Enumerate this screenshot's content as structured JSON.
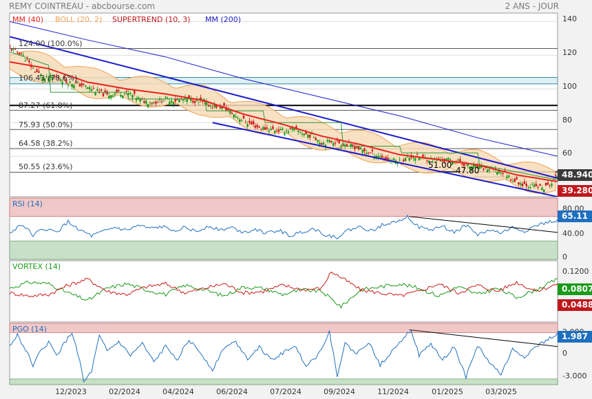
{
  "header": {
    "title": "REMY COINTREAU - abcbourse.com",
    "period": "2 ANS - JOUR"
  },
  "colors": {
    "mm40": "#e8231c",
    "boll": "#f0a050",
    "supertrend": "#c0181c",
    "mm200": "#1a1acc",
    "channel": "#1a1acc",
    "rsi": "#1f6fbf",
    "vortex_plus": "#1a9a1a",
    "vortex_minus": "#cc1a1a",
    "pgo": "#1f6fbf",
    "overbought_zone": "#f0c8c8",
    "oversold_zone": "#c8e0c8",
    "badge_price": "#3a3a3a",
    "badge_red": "#c0181c",
    "badge_blue": "#1f6fbf",
    "badge_green": "#1a9a1a"
  },
  "chart_data": [
    {
      "type": "line",
      "title": "",
      "legend": [
        {
          "name": "MM (40)",
          "color": "#e8231c"
        },
        {
          "name": "BOLL (20, 2)",
          "color": "#f0a050"
        },
        {
          "name": "SUPERTREND (10, 3)",
          "color": "#c0181c"
        },
        {
          "name": "MM (200)",
          "color": "#1a1acc"
        }
      ],
      "ylim": [
        36,
        145
      ],
      "yticks": [
        140,
        120,
        100,
        80,
        60
      ],
      "x_labels": [
        "12/2023",
        "02/2024",
        "04/2024",
        "06/2024",
        "07/2024",
        "09/2024",
        "11/2024",
        "01/2025",
        "03/2025"
      ],
      "x_label_index": [
        20,
        50,
        80,
        110,
        140,
        170,
        200,
        230,
        260
      ],
      "n_points": 282,
      "fibonacci": [
        {
          "label": "124.00  (100.0%)",
          "value": 124.0
        },
        {
          "label": "106.43  (78.6%)",
          "value": 106.43
        },
        {
          "label": "87.27  (61.8%)",
          "value": 87.27
        },
        {
          "label": "75.93  (50.0%)",
          "value": 75.93
        },
        {
          "label": "64.58  (38.2%)",
          "value": 64.58
        },
        {
          "label": "50.55  (23.6%)",
          "value": 50.55
        }
      ],
      "horizontal_lines": [
        106.8,
        103.0,
        90.2
      ],
      "annotations": [
        {
          "label": "51.00",
          "x": 222,
          "y": 51.0
        },
        {
          "label": "47.80",
          "x": 246,
          "y": 47.8
        }
      ],
      "close_points": [
        [
          0,
          124
        ],
        [
          6,
          121
        ],
        [
          12,
          112
        ],
        [
          18,
          106
        ],
        [
          24,
          107
        ],
        [
          30,
          104
        ],
        [
          38,
          102
        ],
        [
          44,
          99
        ],
        [
          50,
          96
        ],
        [
          55,
          98
        ],
        [
          62,
          97
        ],
        [
          68,
          93
        ],
        [
          74,
          92
        ],
        [
          80,
          94
        ],
        [
          86,
          93
        ],
        [
          92,
          94
        ],
        [
          98,
          92
        ],
        [
          104,
          90
        ],
        [
          110,
          89
        ],
        [
          116,
          84
        ],
        [
          122,
          80
        ],
        [
          128,
          77
        ],
        [
          134,
          76
        ],
        [
          140,
          75
        ],
        [
          146,
          76
        ],
        [
          152,
          73
        ],
        [
          156,
          72
        ],
        [
          160,
          68
        ],
        [
          166,
          69
        ],
        [
          172,
          67
        ],
        [
          176,
          66
        ],
        [
          182,
          63
        ],
        [
          188,
          61
        ],
        [
          194,
          58
        ],
        [
          200,
          57
        ],
        [
          206,
          60
        ],
        [
          212,
          59
        ],
        [
          218,
          58
        ],
        [
          224,
          58
        ],
        [
          230,
          57
        ],
        [
          236,
          54
        ],
        [
          242,
          53
        ],
        [
          248,
          52
        ],
        [
          254,
          50
        ],
        [
          258,
          46
        ],
        [
          262,
          44
        ],
        [
          266,
          43
        ],
        [
          270,
          42
        ],
        [
          274,
          41
        ],
        [
          278,
          44
        ],
        [
          281,
          48.9
        ]
      ],
      "mm40_points": [
        [
          0,
          116
        ],
        [
          20,
          112
        ],
        [
          40,
          104
        ],
        [
          60,
          100
        ],
        [
          80,
          97
        ],
        [
          100,
          93
        ],
        [
          120,
          85
        ],
        [
          140,
          79
        ],
        [
          160,
          72
        ],
        [
          180,
          67
        ],
        [
          200,
          61
        ],
        [
          220,
          58
        ],
        [
          240,
          55
        ],
        [
          260,
          49
        ],
        [
          281,
          45
        ]
      ],
      "mm200_points": [
        [
          0,
          140
        ],
        [
          40,
          129
        ],
        [
          80,
          119
        ],
        [
          120,
          106
        ],
        [
          160,
          95
        ],
        [
          200,
          84
        ],
        [
          240,
          71
        ],
        [
          281,
          60
        ]
      ],
      "supertrend_points": [
        [
          0,
          122
        ],
        [
          20,
          114
        ],
        [
          21,
          98
        ],
        [
          60,
          98
        ],
        [
          61,
          94
        ],
        [
          100,
          94
        ],
        [
          101,
          87
        ],
        [
          130,
          87
        ],
        [
          131,
          80
        ],
        [
          170,
          80
        ],
        [
          171,
          66
        ],
        [
          200,
          66
        ],
        [
          201,
          62
        ],
        [
          240,
          62
        ],
        [
          241,
          55
        ],
        [
          281,
          46
        ]
      ],
      "channel_upper": [
        [
          0,
          131
        ],
        [
          281,
          47
        ]
      ],
      "channel_lower": [
        [
          104,
          80
        ],
        [
          281,
          36
        ]
      ],
      "last_price": 48.94,
      "last_supertrend": 39.28
    },
    {
      "type": "line",
      "title": "RSI (14)",
      "series": [
        {
          "name": "RSI (14)",
          "color": "#1f6fbf"
        }
      ],
      "ylim": [
        0,
        100
      ],
      "yticks": [
        80,
        40,
        0
      ],
      "zones": {
        "overbought": [
          70,
          100
        ],
        "oversold": [
          0,
          30
        ]
      },
      "points": [
        [
          0,
          42
        ],
        [
          6,
          58
        ],
        [
          12,
          40
        ],
        [
          18,
          50
        ],
        [
          24,
          44
        ],
        [
          30,
          61
        ],
        [
          36,
          48
        ],
        [
          42,
          38
        ],
        [
          48,
          45
        ],
        [
          54,
          52
        ],
        [
          60,
          47
        ],
        [
          66,
          55
        ],
        [
          72,
          50
        ],
        [
          78,
          53
        ],
        [
          84,
          48
        ],
        [
          90,
          52
        ],
        [
          96,
          45
        ],
        [
          102,
          55
        ],
        [
          108,
          48
        ],
        [
          114,
          52
        ],
        [
          120,
          44
        ],
        [
          126,
          50
        ],
        [
          132,
          42
        ],
        [
          138,
          48
        ],
        [
          144,
          38
        ],
        [
          150,
          45
        ],
        [
          156,
          50
        ],
        [
          162,
          40
        ],
        [
          168,
          36
        ],
        [
          174,
          48
        ],
        [
          180,
          53
        ],
        [
          186,
          46
        ],
        [
          192,
          58
        ],
        [
          198,
          62
        ],
        [
          204,
          70
        ],
        [
          210,
          52
        ],
        [
          216,
          48
        ],
        [
          222,
          54
        ],
        [
          228,
          44
        ],
        [
          234,
          56
        ],
        [
          240,
          40
        ],
        [
          246,
          48
        ],
        [
          252,
          43
        ],
        [
          258,
          52
        ],
        [
          264,
          46
        ],
        [
          270,
          55
        ],
        [
          276,
          60
        ],
        [
          281,
          65.11
        ]
      ],
      "trendline": [
        [
          205,
          70
        ],
        [
          281,
          44
        ]
      ],
      "last_value": 65.11
    },
    {
      "type": "line",
      "title": "VORTEX (14)",
      "yticks": [
        0.12
      ],
      "ylim": [
        -0.2,
        0.2
      ],
      "series": [
        {
          "name": "VI+",
          "color": "#1a9a1a",
          "points": [
            [
              0,
              0.02
            ],
            [
              10,
              0.06
            ],
            [
              20,
              0.05
            ],
            [
              30,
              -0.01
            ],
            [
              40,
              -0.06
            ],
            [
              50,
              0.02
            ],
            [
              60,
              0.05
            ],
            [
              70,
              0.01
            ],
            [
              80,
              -0.02
            ],
            [
              90,
              0.04
            ],
            [
              100,
              0.01
            ],
            [
              110,
              -0.03
            ],
            [
              120,
              0.03
            ],
            [
              130,
              0.02
            ],
            [
              140,
              -0.02
            ],
            [
              150,
              0.01
            ],
            [
              160,
              0.0
            ],
            [
              170,
              -0.1
            ],
            [
              180,
              0.01
            ],
            [
              190,
              0.03
            ],
            [
              200,
              0.05
            ],
            [
              210,
              0.02
            ],
            [
              220,
              -0.03
            ],
            [
              230,
              0.03
            ],
            [
              240,
              -0.02
            ],
            [
              250,
              0.02
            ],
            [
              260,
              -0.04
            ],
            [
              270,
              0.01
            ],
            [
              281,
              0.0807
            ]
          ]
        },
        {
          "name": "VI-",
          "color": "#cc1a1a",
          "points": [
            [
              0,
              -0.01
            ],
            [
              10,
              -0.03
            ],
            [
              20,
              -0.02
            ],
            [
              30,
              0.04
            ],
            [
              40,
              0.08
            ],
            [
              50,
              0.0
            ],
            [
              60,
              -0.02
            ],
            [
              70,
              0.03
            ],
            [
              80,
              0.05
            ],
            [
              90,
              -0.01
            ],
            [
              100,
              0.02
            ],
            [
              110,
              0.05
            ],
            [
              120,
              -0.01
            ],
            [
              130,
              0.0
            ],
            [
              140,
              0.04
            ],
            [
              150,
              0.01
            ],
            [
              160,
              0.02
            ],
            [
              165,
              0.13
            ],
            [
              170,
              0.09
            ],
            [
              180,
              0.01
            ],
            [
              190,
              -0.01
            ],
            [
              200,
              -0.03
            ],
            [
              210,
              0.0
            ],
            [
              220,
              0.05
            ],
            [
              230,
              -0.01
            ],
            [
              240,
              0.04
            ],
            [
              250,
              0.0
            ],
            [
              260,
              0.06
            ],
            [
              270,
              0.0
            ],
            [
              281,
              0.0488
            ]
          ]
        }
      ],
      "last_plus": 0.0807,
      "last_minus": 0.0488
    },
    {
      "type": "line",
      "title": "PGO (14)",
      "series": [
        {
          "name": "PGO (14)",
          "color": "#1f6fbf"
        }
      ],
      "ylim": [
        -3.6,
        3.0
      ],
      "yticks": [
        2.0,
        0,
        -3.0
      ],
      "zones": {
        "overbought": [
          2.0,
          3.0
        ],
        "oversold": [
          -3.6,
          -3.0
        ]
      },
      "points": [
        [
          0,
          0.5
        ],
        [
          4,
          1.8
        ],
        [
          8,
          0.2
        ],
        [
          12,
          -1.5
        ],
        [
          16,
          0.0
        ],
        [
          20,
          1.0
        ],
        [
          24,
          -0.5
        ],
        [
          28,
          0.8
        ],
        [
          32,
          2.0
        ],
        [
          36,
          -1.0
        ],
        [
          38,
          -3.4
        ],
        [
          42,
          -2.2
        ],
        [
          46,
          1.6
        ],
        [
          50,
          0.0
        ],
        [
          56,
          1.0
        ],
        [
          62,
          -0.5
        ],
        [
          68,
          0.8
        ],
        [
          74,
          -1.2
        ],
        [
          80,
          0.5
        ],
        [
          86,
          -0.8
        ],
        [
          92,
          1.2
        ],
        [
          98,
          -0.2
        ],
        [
          104,
          -2.0
        ],
        [
          110,
          0.4
        ],
        [
          116,
          1.0
        ],
        [
          122,
          -0.8
        ],
        [
          128,
          0.5
        ],
        [
          134,
          -1.0
        ],
        [
          140,
          -0.2
        ],
        [
          146,
          0.6
        ],
        [
          152,
          -1.5
        ],
        [
          158,
          -0.5
        ],
        [
          164,
          2.1
        ],
        [
          168,
          -2.6
        ],
        [
          172,
          0.8
        ],
        [
          178,
          -0.3
        ],
        [
          184,
          1.0
        ],
        [
          190,
          -1.5
        ],
        [
          196,
          0.0
        ],
        [
          202,
          1.5
        ],
        [
          206,
          2.3
        ],
        [
          210,
          -0.5
        ],
        [
          216,
          0.8
        ],
        [
          222,
          -1.0
        ],
        [
          228,
          0.5
        ],
        [
          234,
          -2.8
        ],
        [
          240,
          0.6
        ],
        [
          246,
          -1.2
        ],
        [
          252,
          -2.5
        ],
        [
          258,
          0.2
        ],
        [
          264,
          -0.6
        ],
        [
          270,
          0.5
        ],
        [
          276,
          1.2
        ],
        [
          281,
          1.987
        ]
      ],
      "trendline": [
        [
          205,
          2.3
        ],
        [
          281,
          0.5
        ]
      ],
      "last_value": 1.987
    }
  ],
  "badges": {
    "price": "48.940",
    "supertrend": "39.280",
    "rsi": "65.11",
    "vortex_plus": "0.0807",
    "vortex_minus": "0.0488",
    "pgo": "1.987"
  },
  "panel_ticks": {
    "rsi": [
      "80.00",
      "40.00",
      "0"
    ],
    "vortex": [
      "0.1200"
    ],
    "pgo": [
      "2.000",
      "0",
      "-3.000"
    ]
  }
}
